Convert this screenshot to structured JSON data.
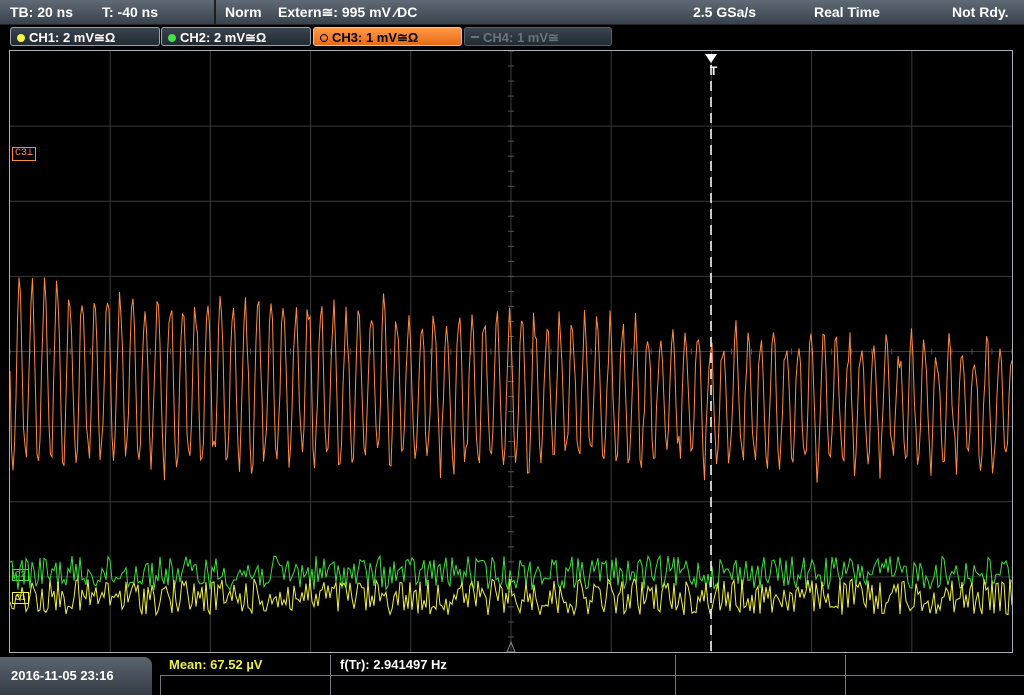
{
  "topbar": {
    "timebase": "TB: 20 ns",
    "trigger_time": "T: -40 ns",
    "trigger_mode": "Norm",
    "trigger_source": "Extern≅: 995 mV ⁄DC",
    "sample_rate": "2.5 GSa/s",
    "acq_mode": "Real Time",
    "status": "Not Rdy."
  },
  "channels": [
    {
      "label": "CH1: 2 mV≅Ω",
      "color": "#f5f542"
    },
    {
      "label": "CH2: 2 mV≅Ω",
      "color": "#45e045"
    },
    {
      "label": "CH3: 1 mV≅Ω",
      "color": "#ff8c3a"
    },
    {
      "label": "CH4: 1 mV≅",
      "color": "#6c737a"
    }
  ],
  "screen": {
    "trigger_marker": "T",
    "ch3_marker": "C3⊥",
    "ch2_marker": "C2",
    "ch1_marker": "C1"
  },
  "bottombar": {
    "datetime": "2016-11-05 23:16",
    "mean": "Mean: 67.52 µV",
    "freq": "f(Tr): 2.941497 Hz"
  },
  "colors": {
    "ch1": "#f0f040",
    "ch2": "#3ddf3d",
    "ch3": "#ff8a3d",
    "grid": "#3a3a3a",
    "trigger_line": "#ffffff"
  }
}
